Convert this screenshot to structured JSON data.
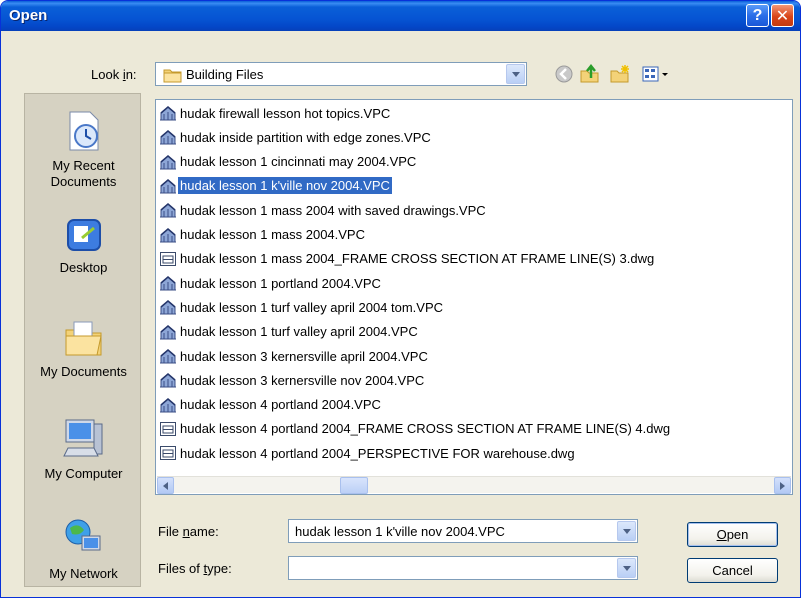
{
  "window": {
    "title": "Open",
    "help_glyph": "?",
    "close_glyph": "✕"
  },
  "toolbar": {
    "lookin_label_pre": "Look ",
    "lookin_label_ul": "i",
    "lookin_label_post": "n:",
    "lookin_value": "Building Files",
    "icons": [
      "back-icon",
      "up-folder-icon",
      "new-folder-icon",
      "view-menu-icon"
    ]
  },
  "places": [
    {
      "label": "My Recent Documents",
      "label_1": "My Recent",
      "label_2": "Documents",
      "icon": "recent-documents-icon"
    },
    {
      "label": "Desktop",
      "icon": "desktop-icon"
    },
    {
      "label": "My Documents",
      "icon": "my-documents-icon"
    },
    {
      "label": "My Computer",
      "icon": "my-computer-icon"
    },
    {
      "label": "My Network",
      "icon": "my-network-icon"
    }
  ],
  "files": [
    {
      "name": "hudak firewall lesson hot topics.VPC",
      "type": "vpc"
    },
    {
      "name": "hudak inside partition with edge zones.VPC",
      "type": "vpc"
    },
    {
      "name": "hudak lesson 1 cincinnati may 2004.VPC",
      "type": "vpc"
    },
    {
      "name": "hudak lesson 1 k'ville nov 2004.VPC",
      "type": "vpc",
      "selected": true
    },
    {
      "name": "hudak lesson 1 mass 2004 with saved drawings.VPC",
      "type": "vpc"
    },
    {
      "name": "hudak lesson 1 mass 2004.VPC",
      "type": "vpc"
    },
    {
      "name": "hudak lesson 1 mass 2004_FRAME CROSS SECTION AT FRAME LINE(S) 3.dwg",
      "type": "dwg"
    },
    {
      "name": "hudak lesson 1 portland 2004.VPC",
      "type": "vpc"
    },
    {
      "name": "hudak lesson 1 turf valley april 2004 tom.VPC",
      "type": "vpc"
    },
    {
      "name": "hudak lesson 1 turf valley april 2004.VPC",
      "type": "vpc"
    },
    {
      "name": "hudak lesson 3 kernersville april 2004.VPC",
      "type": "vpc"
    },
    {
      "name": "hudak lesson 3 kernersville nov 2004.VPC",
      "type": "vpc"
    },
    {
      "name": "hudak lesson 4 portland 2004.VPC",
      "type": "vpc"
    },
    {
      "name": "hudak lesson 4 portland 2004_FRAME CROSS SECTION AT FRAME LINE(S) 4.dwg",
      "type": "dwg"
    },
    {
      "name": "hudak lesson 4 portland 2004_PERSPECTIVE FOR warehouse.dwg",
      "type": "dwg"
    }
  ],
  "form": {
    "filename_label_pre": "File ",
    "filename_label_ul": "n",
    "filename_label_post": "ame:",
    "filename_value": "hudak lesson 1 k'ville nov 2004.VPC",
    "filetype_label_pre": "Files of ",
    "filetype_label_ul": "t",
    "filetype_label_post": "ype:",
    "filetype_value": ""
  },
  "buttons": {
    "open_ul": "O",
    "open_rest": "pen",
    "cancel": "Cancel"
  },
  "colors": {
    "selection": "#316ac5",
    "titlebar": "#0654d3",
    "dialog_bg": "#ece9d8"
  }
}
